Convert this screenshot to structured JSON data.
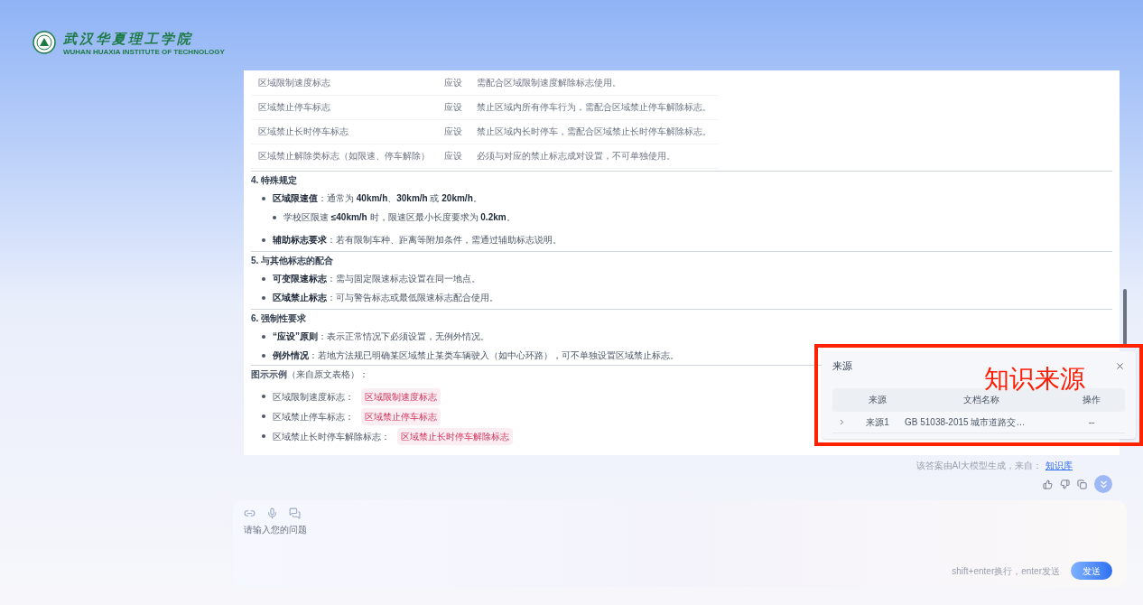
{
  "header": {
    "logo_name": "武汉华夏理工学院",
    "logo_subtitle": "WUHAN HUAXIA INSTITUTE OF TECHNOLOGY"
  },
  "table": {
    "rows": [
      {
        "sign": "区域限制速度标志",
        "requirement": "应设",
        "note": "需配合区域限制速度解除标志使用。"
      },
      {
        "sign": "区域禁止停车标志",
        "requirement": "应设",
        "note": "禁止区域内所有停车行为，需配合区域禁止停车解除标志。"
      },
      {
        "sign": "区域禁止长时停车标志",
        "requirement": "应设",
        "note": "禁止区域内长时停车，需配合区域禁止长时停车解除标志。"
      },
      {
        "sign": "区域禁止解除类标志（如限速、停车解除）",
        "requirement": "应设",
        "note": "必须与对应的禁止标志成对设置，不可单独使用。"
      }
    ]
  },
  "sections": [
    {
      "title": "4. 特殊规定",
      "items": [
        {
          "text": "**区域限速值**：通常为 **40km/h**、**30km/h** 或 **20km/h**。",
          "children": [
            {
              "text": "学校区限速 **≤40km/h** 时，限速区最小长度要求为 **0.2km**。"
            }
          ]
        },
        {
          "text": "**辅助标志要求**：若有限制车种、距离等附加条件，需通过辅助标志说明。"
        }
      ]
    },
    {
      "title": "5. 与其他标志的配合",
      "items": [
        {
          "text": "**可变限速标志**：需与固定限速标志设置在同一地点。"
        },
        {
          "text": "**区域禁止标志**：可与警告标志或最低限速标志配合使用。"
        }
      ]
    },
    {
      "title": "6. 强制性要求",
      "items": [
        {
          "text": "**“应设”原则**：表示正常情况下必须设置，无例外情况。"
        },
        {
          "text": "**例外情况**：若地方法规已明确某区域禁止某类车辆驶入（如中心环路），可不单独设置区域禁止标志。"
        }
      ]
    }
  ],
  "examples": {
    "title": "**图示示例**（来自原文表格）：",
    "items": [
      {
        "label": "区域限制速度标志：",
        "tag": "区域限制速度标志"
      },
      {
        "label": "区域禁止停车标志：",
        "tag": "区域禁止停车标志"
      },
      {
        "label": "区域禁止长时停车解除标志：",
        "tag": "区域禁止长时停车解除标志"
      }
    ]
  },
  "footer_note": {
    "text": "该答案由AI大模型生成，来自：",
    "link": "知识库"
  },
  "sources_popup": {
    "title": "来源",
    "columns": [
      "来源",
      "文档名称",
      "操作"
    ],
    "rows": [
      {
        "expanded": false,
        "source": "来源1",
        "document": "GB 51038-2015 城市道路交…",
        "action": "--"
      }
    ]
  },
  "annotation": {
    "label": "知识来源"
  },
  "input": {
    "placeholder": "请输入您的问题",
    "hint": "shift+enter换行，enter发送",
    "send": "发送"
  }
}
